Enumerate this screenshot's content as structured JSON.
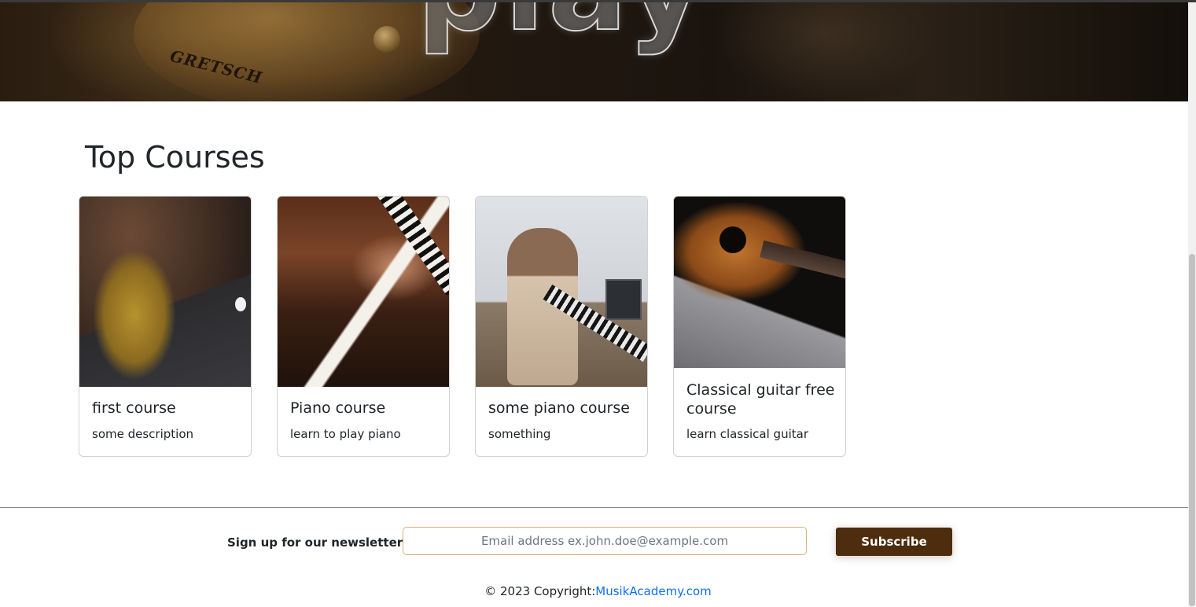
{
  "hero": {
    "word": "play",
    "guitar_brand": "GRETSCH"
  },
  "top_courses": {
    "title": "Top Courses",
    "courses": [
      {
        "title": "first course",
        "description": "some description",
        "image": "guitar-laptop-photo"
      },
      {
        "title": "Piano course",
        "description": "learn to play piano",
        "image": "piano-hands-photo"
      },
      {
        "title": "some piano course",
        "description": "something",
        "image": "girl-keyboard-photo"
      },
      {
        "title": "Classical guitar free course",
        "description": "learn classical guitar",
        "image": "acoustic-guitar-photo"
      }
    ]
  },
  "footer": {
    "newsletter_label": "Sign up for our newsletter",
    "email_placeholder": "Email address ex.john.doe@example.com",
    "email_value": "",
    "subscribe_label": "Subscribe",
    "copyright_prefix": "© 2023 Copyright:",
    "copyright_link": "MusikAcademy.com"
  },
  "colors": {
    "subscribe_bg": "#4e2c0e",
    "input_border": "#d9b07a",
    "link": "#0d6efd"
  }
}
